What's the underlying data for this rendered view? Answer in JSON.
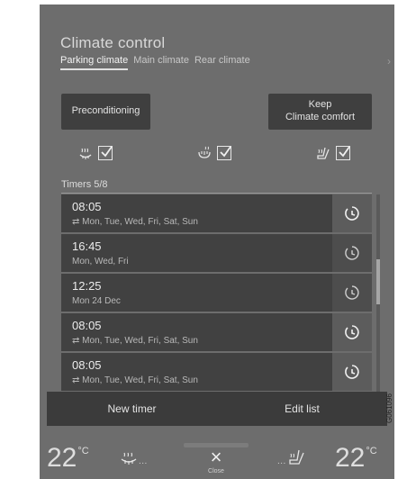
{
  "header": {
    "title": "Climate control",
    "tabs": [
      {
        "label": "Parking climate",
        "active": true
      },
      {
        "label": "Main climate",
        "active": false
      },
      {
        "label": "Rear climate",
        "active": false
      }
    ],
    "more_arrow": "›"
  },
  "actions": {
    "preconditioning_label": "Preconditioning",
    "keep_line1": "Keep",
    "keep_line2": "Climate comfort"
  },
  "seat_options": [
    {
      "icon": "steering-wheel-heat-icon",
      "checked": true
    },
    {
      "icon": "rear-defroster-icon",
      "checked": true
    },
    {
      "icon": "seat-heat-icon",
      "checked": true
    }
  ],
  "timers": {
    "label": "Timers 5/8",
    "items": [
      {
        "time": "08:05",
        "repeat": true,
        "days": "Mon, Tue, Wed, Fri, Sat, Sun",
        "selected": true
      },
      {
        "time": "16:45",
        "repeat": false,
        "days": "Mon, Wed, Fri",
        "selected": false
      },
      {
        "time": "12:25",
        "repeat": false,
        "days": "Mon 24 Dec",
        "selected": false
      },
      {
        "time": "08:05",
        "repeat": true,
        "days": "Mon, Tue, Wed, Fri, Sat, Sun",
        "selected": true
      },
      {
        "time": "08:05",
        "repeat": true,
        "days": "Mon, Tue, Wed, Fri, Sat, Sun",
        "selected": true
      }
    ]
  },
  "bottom": {
    "new_timer_label": "New timer",
    "edit_list_label": "Edit list"
  },
  "status_bar": {
    "temp_left": "22",
    "temp_right": "22",
    "unit": "°C",
    "close_label": "Close",
    "close_symbol": "×",
    "dots": "..."
  },
  "figure_code": "G061096",
  "colors": {
    "screen_bg": "#6d6d6d",
    "button_bg": "#3f3f3f",
    "row_bg": "#414141"
  }
}
